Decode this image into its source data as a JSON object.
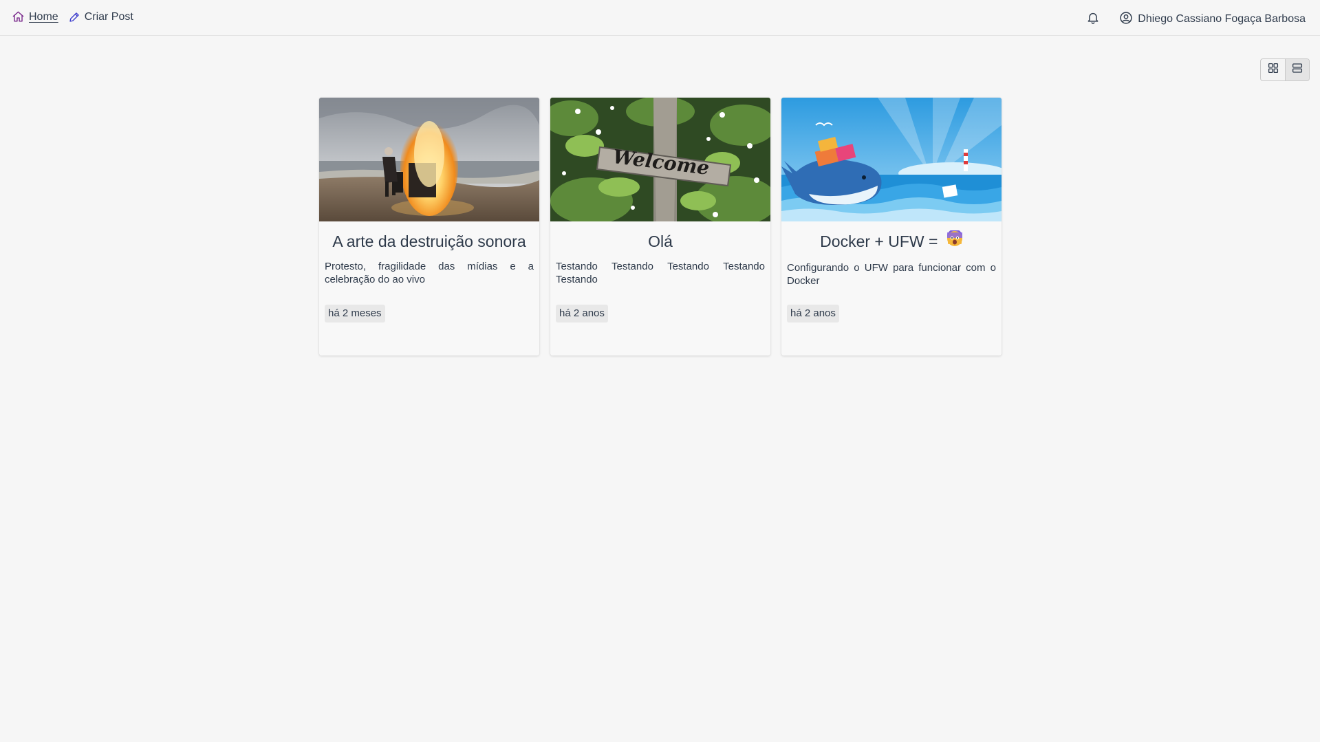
{
  "nav": {
    "home_label": "Home",
    "create_post_label": "Criar Post",
    "user_name": "Dhiego Cassiano Fogaça Barbosa",
    "icons": [
      "home-icon",
      "pencil-icon",
      "bell-icon",
      "user-circle-icon"
    ]
  },
  "view_toggle": {
    "options": [
      "grid-view",
      "list-view"
    ],
    "active": "list-view"
  },
  "posts": [
    {
      "title": "A arte da destruição sonora",
      "description": "Protesto, fragilidade das mídias e a celebração do ao vivo",
      "date": "há 2 meses",
      "image": "burning-piano-on-beach"
    },
    {
      "title": "Olá",
      "description": "Testando Testando Testando Testando Testando",
      "date": "há 2 anos",
      "image": "welcome-wooden-sign"
    },
    {
      "title": "Docker + UFW =",
      "description": "Configurando o UFW para funcionar com o Docker",
      "date": "há 2 anos",
      "image": "docker-whale-illustration",
      "title_emoji": "scared-face-emoji"
    }
  ],
  "colors": {
    "background": "#f6f6f6",
    "text": "#2e3a4a",
    "home_icon": "#7a2a8c",
    "pencil_icon": "#3a3acc",
    "tag_bg": "#e8e8e8"
  }
}
